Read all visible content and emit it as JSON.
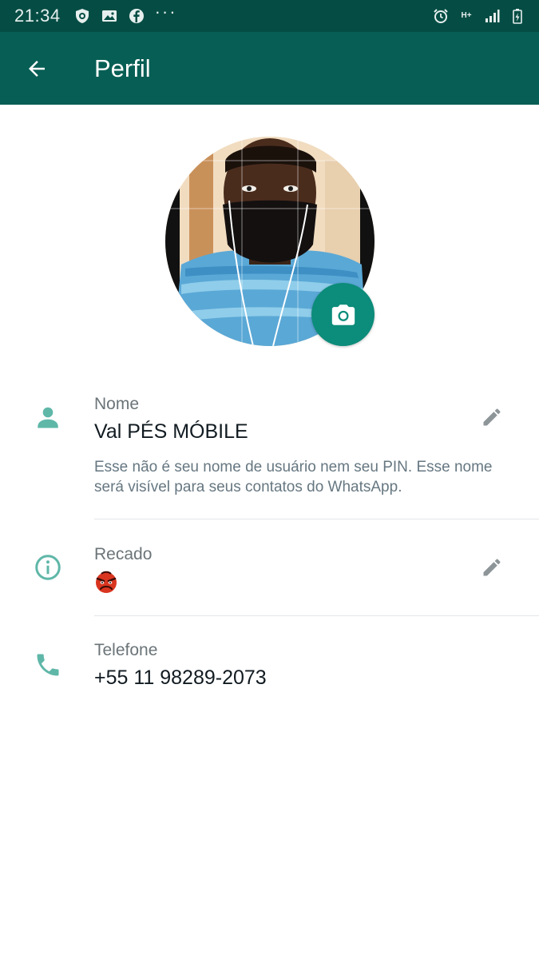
{
  "status_bar": {
    "time": "21:34",
    "network_label": "H+",
    "left_icons": [
      "shield-icon",
      "image-icon",
      "facebook-icon",
      "more-dots-icon"
    ],
    "right_icons": [
      "alarm-icon",
      "network-icon",
      "signal-icon",
      "battery-icon"
    ]
  },
  "app_bar": {
    "title": "Perfil",
    "back_icon": "arrow-back-icon",
    "background": "#075e54"
  },
  "profile": {
    "camera_icon": "camera-icon",
    "accent": "#0c8c7a"
  },
  "name_section": {
    "label": "Nome",
    "value": "Val PÉS MÓBILE",
    "hint": "Esse não é seu nome de usuário nem seu PIN. Esse nome será visível para seus contatos do WhatsApp.",
    "icon": "person-icon",
    "edit_icon": "pencil-icon"
  },
  "about_section": {
    "label": "Recado",
    "value_emoji": "angry-face-emoji",
    "icon": "info-icon",
    "edit_icon": "pencil-icon"
  },
  "phone_section": {
    "label": "Telefone",
    "value": "+55 11 98289-2073",
    "icon": "phone-icon"
  },
  "colors": {
    "status_bar": "#054d44",
    "icon_teal": "#5fb7a8",
    "edit_gray": "#8d9598"
  }
}
